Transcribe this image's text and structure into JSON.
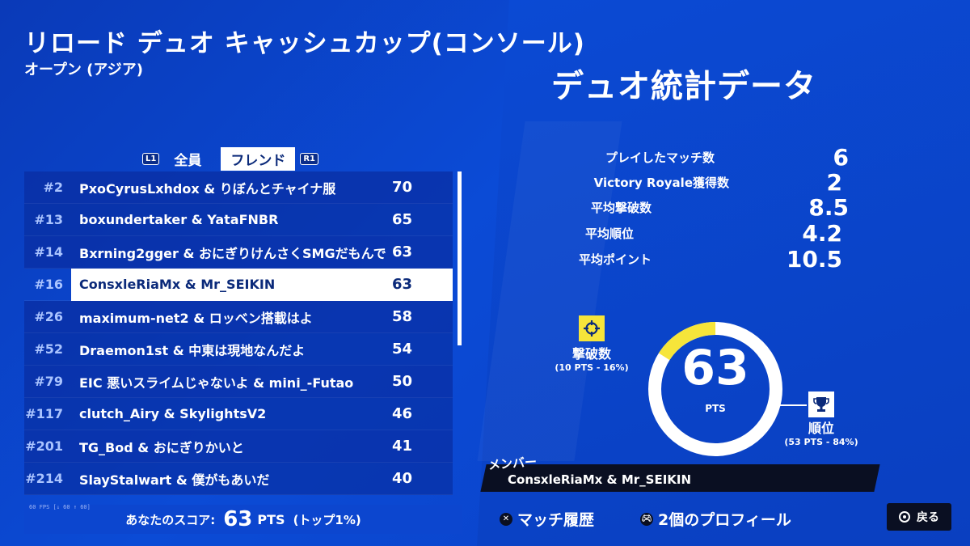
{
  "event": {
    "title": "リロード デュオ キャッシュカップ(コンソール)",
    "subtitle": "オープン (アジア)"
  },
  "stats_title": "デュオ統計データ",
  "tabs": {
    "left_key": "L1",
    "right_key": "R1",
    "items": [
      {
        "label": "全員",
        "active": false
      },
      {
        "label": "フレンド",
        "active": true
      }
    ]
  },
  "leaderboard": [
    {
      "rank": "#2",
      "names": "PxoCyrusLxhdox & りぼんとチャイナ服",
      "points": "70"
    },
    {
      "rank": "#13",
      "names": "boxundertaker & YataFNBR",
      "points": "65"
    },
    {
      "rank": "#14",
      "names": "Bxrning2gger & おにぎりけんさくSMGだもんで",
      "points": "63"
    },
    {
      "rank": "#16",
      "names": "ConsxleRiaMx & Mr_SEIKIN",
      "points": "63",
      "selected": true
    },
    {
      "rank": "#26",
      "names": "maximum-net2 & ロッベン搭載はよ",
      "points": "58"
    },
    {
      "rank": "#52",
      "names": "Draemon1st & 中東は現地なんだよ",
      "points": "54"
    },
    {
      "rank": "#79",
      "names": "EIC 悪いスライムじゃないよ & mini_-Futao",
      "points": "50"
    },
    {
      "rank": "#117",
      "names": "clutch_Airy & SkylightsV2",
      "points": "46"
    },
    {
      "rank": "#201",
      "names": "TG_Bod & おにぎりかいと",
      "points": "41"
    },
    {
      "rank": "#214",
      "names": "SlayStalwart & 僕がもあいだ",
      "points": "40"
    }
  ],
  "score": {
    "label": "あなたのスコア:",
    "value": "63",
    "unit": "PTS",
    "top": "(トップ1%)",
    "fps": "60 FPS [↓ 60 ↑ 60]"
  },
  "stats": [
    {
      "label": "プレイしたマッチ数",
      "value": "6"
    },
    {
      "label": "Victory Royale獲得数",
      "value": "2"
    },
    {
      "label": "平均撃破数",
      "value": "8.5"
    },
    {
      "label": "平均順位",
      "value": "4.2"
    },
    {
      "label": "平均ポイント",
      "value": "10.5"
    }
  ],
  "ring": {
    "total": "63",
    "unit": "PTS",
    "elim_fraction": 0.16,
    "elim_color": "#f6e53a",
    "place_color": "#ffffff",
    "elim_label": "撃破数",
    "elim_detail": "(10 PTS - 16%)",
    "place_label": "順位",
    "place_detail": "(53 PTS - 84%)"
  },
  "member": {
    "title": "メンバー",
    "names": "ConsxleRiaMx & Mr_SEIKIN"
  },
  "controls": {
    "match_history": "マッチ履歴",
    "profiles": "2個のプロフィール",
    "back": "戻る"
  },
  "colors": {
    "background": "#0b46cf",
    "accent_yellow": "#f6e53a",
    "dark": "#0a0f22"
  }
}
